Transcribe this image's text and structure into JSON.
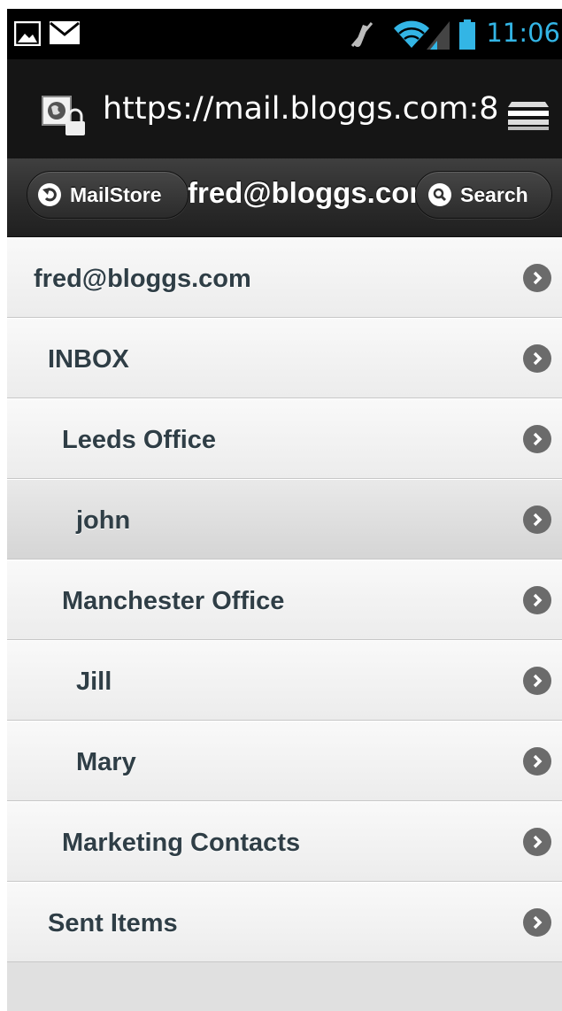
{
  "status_bar": {
    "time": "11:06",
    "icons": [
      "picture-icon",
      "mail-icon",
      "mute-icon",
      "wifi-icon",
      "signal-icon",
      "battery-icon"
    ],
    "accent_color": "#33b5e5"
  },
  "browser": {
    "url": "https://mail.bloggs.com:8",
    "site_icon": "secure-site-icon",
    "menu_icon": "bookmarks-icon"
  },
  "header": {
    "title": "fred@bloggs.com",
    "back_button_label": "MailStore",
    "search_button_label": "Search"
  },
  "folders": [
    {
      "label": "fred@bloggs.com"
    },
    {
      "label": "INBOX"
    },
    {
      "label": "Leeds Office"
    },
    {
      "label": "john"
    },
    {
      "label": "Manchester Office"
    },
    {
      "label": "Jill"
    },
    {
      "label": "Mary"
    },
    {
      "label": "Marketing Contacts"
    },
    {
      "label": "Sent Items"
    }
  ]
}
